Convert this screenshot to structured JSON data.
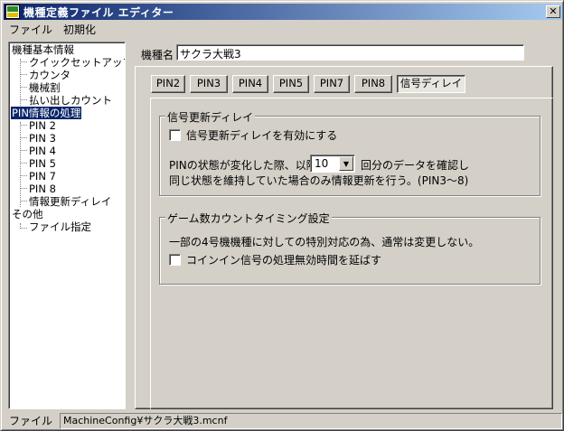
{
  "window": {
    "title": "機種定義ファイル エディター",
    "close": "✕"
  },
  "menu": [
    "ファイル",
    "初期化"
  ],
  "tree": {
    "nodes": [
      {
        "label": "機種基本情報"
      },
      {
        "label": "クイックセットアップ"
      },
      {
        "label": "カウンタ"
      },
      {
        "label": "機械割"
      },
      {
        "label": "払い出しカウント"
      },
      {
        "label": "PIN情報の処理"
      },
      {
        "label": "PIN 2"
      },
      {
        "label": "PIN 3"
      },
      {
        "label": "PIN 4"
      },
      {
        "label": "PIN 5"
      },
      {
        "label": "PIN 7"
      },
      {
        "label": "PIN 8"
      },
      {
        "label": "情報更新ディレイ"
      },
      {
        "label": "その他"
      },
      {
        "label": "ファイル指定"
      }
    ]
  },
  "model": {
    "label": "機種名",
    "value": "サクラ大戦3"
  },
  "tabs": [
    "PIN2",
    "PIN3",
    "PIN4",
    "PIN5",
    "PIN7",
    "PIN8",
    "信号ディレイ"
  ],
  "signal_delay": {
    "legend": "信号更新ディレイ",
    "enable_label": "信号更新ディレイを有効にする",
    "line1_prefix": "PINの状態が変化した際、以降",
    "count_value": "10",
    "line1_suffix": "回分のデータを確認し",
    "line2": "同じ状態を維持していた場合のみ情報更新を行う。(PIN3～8)"
  },
  "game_count": {
    "legend": "ゲーム数カウントタイミング設定",
    "note": "一部の4号機機種に対しての特別対応の為、通常は変更しない。",
    "coin_label": "コインイン信号の処理無効時間を延ばす"
  },
  "status": {
    "label": "ファイル名",
    "value": "MachineConfig¥サクラ大戦3.mcnf"
  }
}
